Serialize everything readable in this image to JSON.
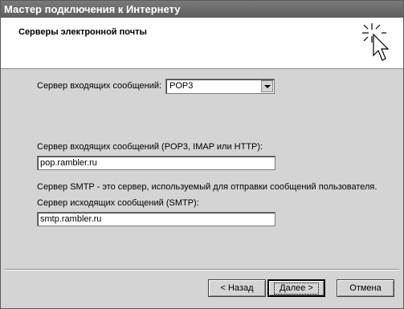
{
  "window": {
    "title": "Мастер подключения к Интернету"
  },
  "header": {
    "title": "Серверы электронной почты",
    "icon": "wizard-cursor-icon"
  },
  "form": {
    "incoming_type_label": "Сервер входящих сообщений:",
    "incoming_type_value": "POP3",
    "incoming_server_label": "Сервер входящих сообщений (POP3, IMAP или HTTP):",
    "incoming_server_value": "pop.rambler.ru",
    "smtp_note": "Сервер SMTP - это сервер, используемый для отправки сообщений  пользователя.",
    "outgoing_server_label": "Сервер исходящих сообщений (SMTP):",
    "outgoing_server_value": "smtp.rambler.ru"
  },
  "buttons": {
    "back": "< Назад",
    "next": "Далее >",
    "cancel": "Отмена"
  }
}
